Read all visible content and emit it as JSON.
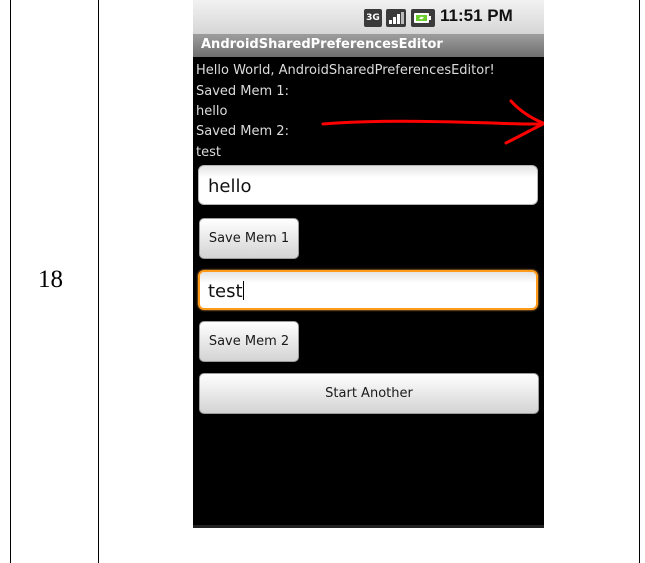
{
  "table": {
    "row_number": "18"
  },
  "status_bar": {
    "network_label": "3G",
    "time": "11:51 PM",
    "icons": [
      "3g-icon",
      "signal-icon",
      "battery-charging-icon"
    ]
  },
  "app": {
    "title": "AndroidSharedPreferencesEditor",
    "hello_text": "Hello World, AndroidSharedPreferencesEditor!",
    "saved_mem1_label": "Saved Mem 1:",
    "saved_mem1_value": "hello",
    "saved_mem2_label": "Saved Mem 2:",
    "saved_mem2_value": "test",
    "input1_value": "hello",
    "input2_value": "test",
    "save_mem1_button": "Save Mem 1",
    "save_mem2_button": "Save Mem 2",
    "start_another_button": "Start Another"
  },
  "annotation": {
    "arrow_color": "#ff0000"
  }
}
